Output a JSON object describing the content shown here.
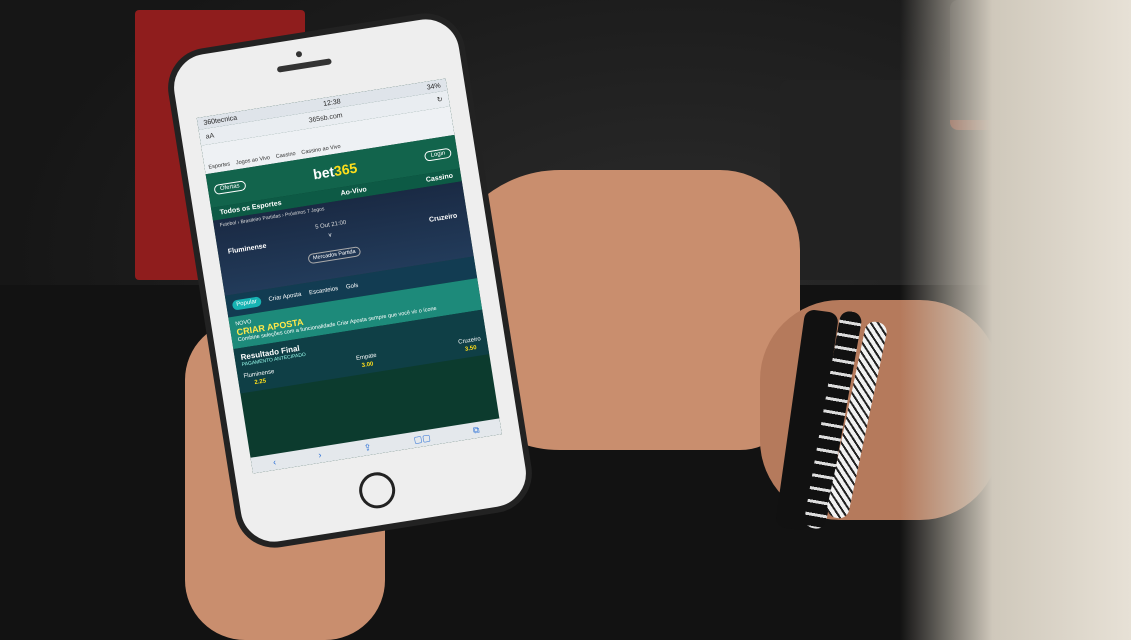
{
  "phone": {
    "status": {
      "carrier": "360tecnica",
      "time": "12:38",
      "battery": "34%"
    },
    "url": {
      "aa": "aA",
      "domain": "365sb.com"
    },
    "nav_links": [
      "Esportes",
      "Jogos ao Vivo",
      "Cassino",
      "Cassino ao Vivo"
    ],
    "header": {
      "menu": "Ofertas",
      "logo_main": "bet",
      "logo_accent": "365",
      "login": "Login"
    },
    "tabs": [
      "Todos os Esportes",
      "Ao-Vivo",
      "Cassino"
    ],
    "match": {
      "breadcrumb": "Futebol › Brasileiro Partidas › Próximos 7 Jogos",
      "home": "Fluminense",
      "away": "Cruzeiro",
      "kickoff": "5 Out 21:00",
      "vs": "v",
      "more": "Mercados Partida"
    },
    "subnav": [
      "Popular",
      "Criar Aposta",
      "Criar Aposta",
      "Escanteios",
      "Gols"
    ],
    "promo": {
      "tag": "NOVO",
      "title": "CRIAR APOSTA",
      "desc": "Combine seleções com a funcionalidade Criar Aposta sempre que você vir o ícone"
    },
    "result": {
      "title": "Resultado Final",
      "subtitle": "PAGAMENTO ANTECIPADO",
      "odds": [
        {
          "label": "Fluminense",
          "value": "2.25"
        },
        {
          "label": "Empate",
          "value": "3.00"
        },
        {
          "label": "Cruzeiro",
          "value": "3.50"
        }
      ]
    },
    "toolbar": [
      "‹",
      "›",
      "⇪",
      "▢▢",
      "⧉"
    ]
  }
}
